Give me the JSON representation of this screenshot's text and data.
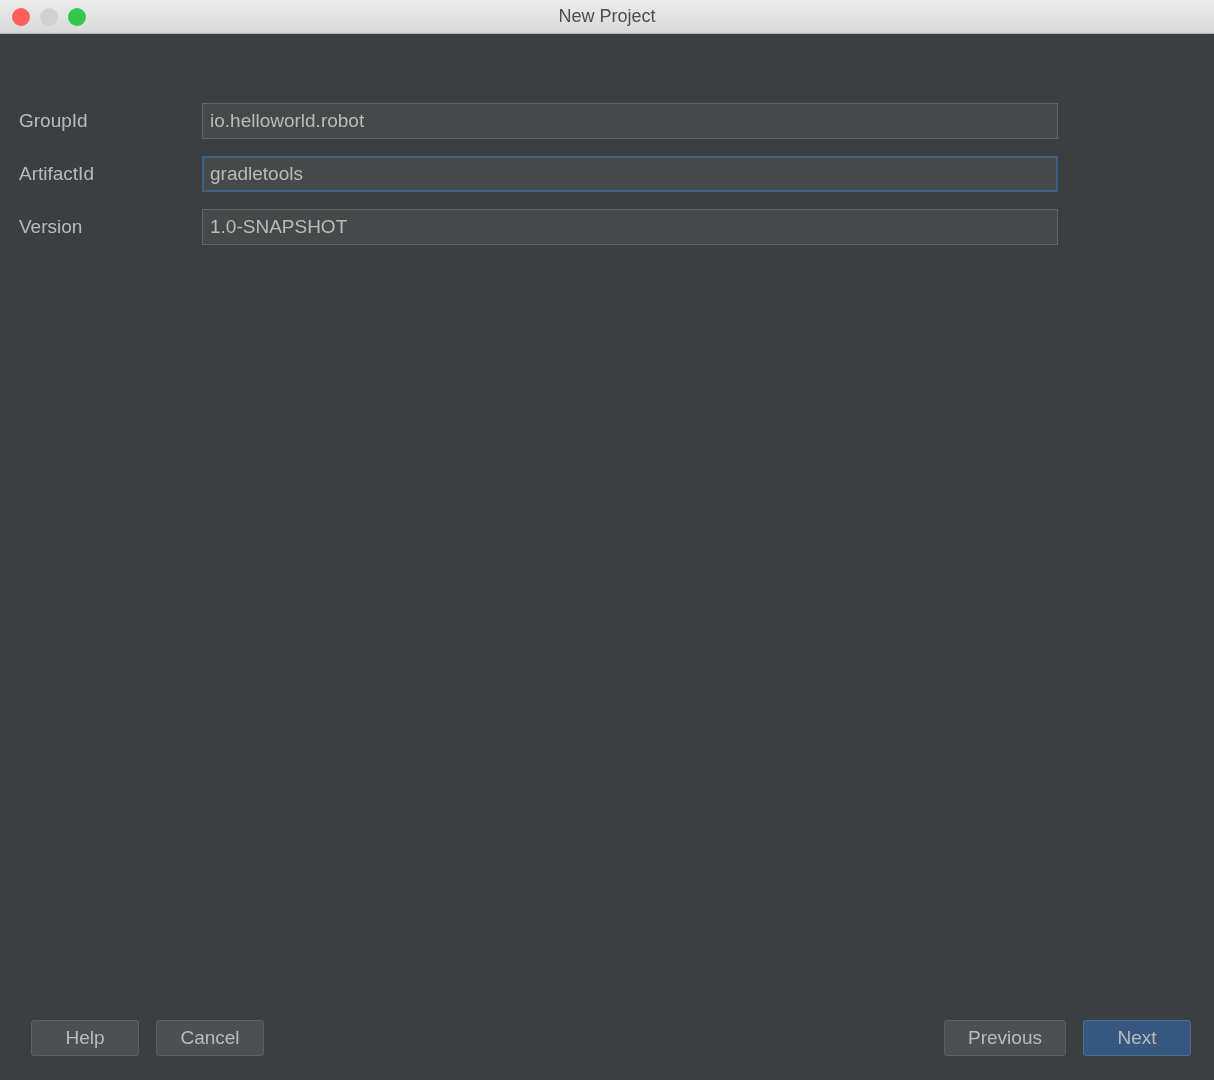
{
  "window": {
    "title": "New Project"
  },
  "fields": [
    {
      "label": "GroupId",
      "value": "io.helloworld.robot",
      "focused": false
    },
    {
      "label": "ArtifactId",
      "value": "gradletools",
      "focused": true
    },
    {
      "label": "Version",
      "value": "1.0-SNAPSHOT",
      "focused": false
    }
  ],
  "buttons_left": [
    {
      "label": "Help",
      "primary": false
    },
    {
      "label": "Cancel",
      "primary": false
    }
  ],
  "buttons_right": [
    {
      "label": "Previous",
      "primary": false
    },
    {
      "label": "Next",
      "primary": true
    }
  ]
}
